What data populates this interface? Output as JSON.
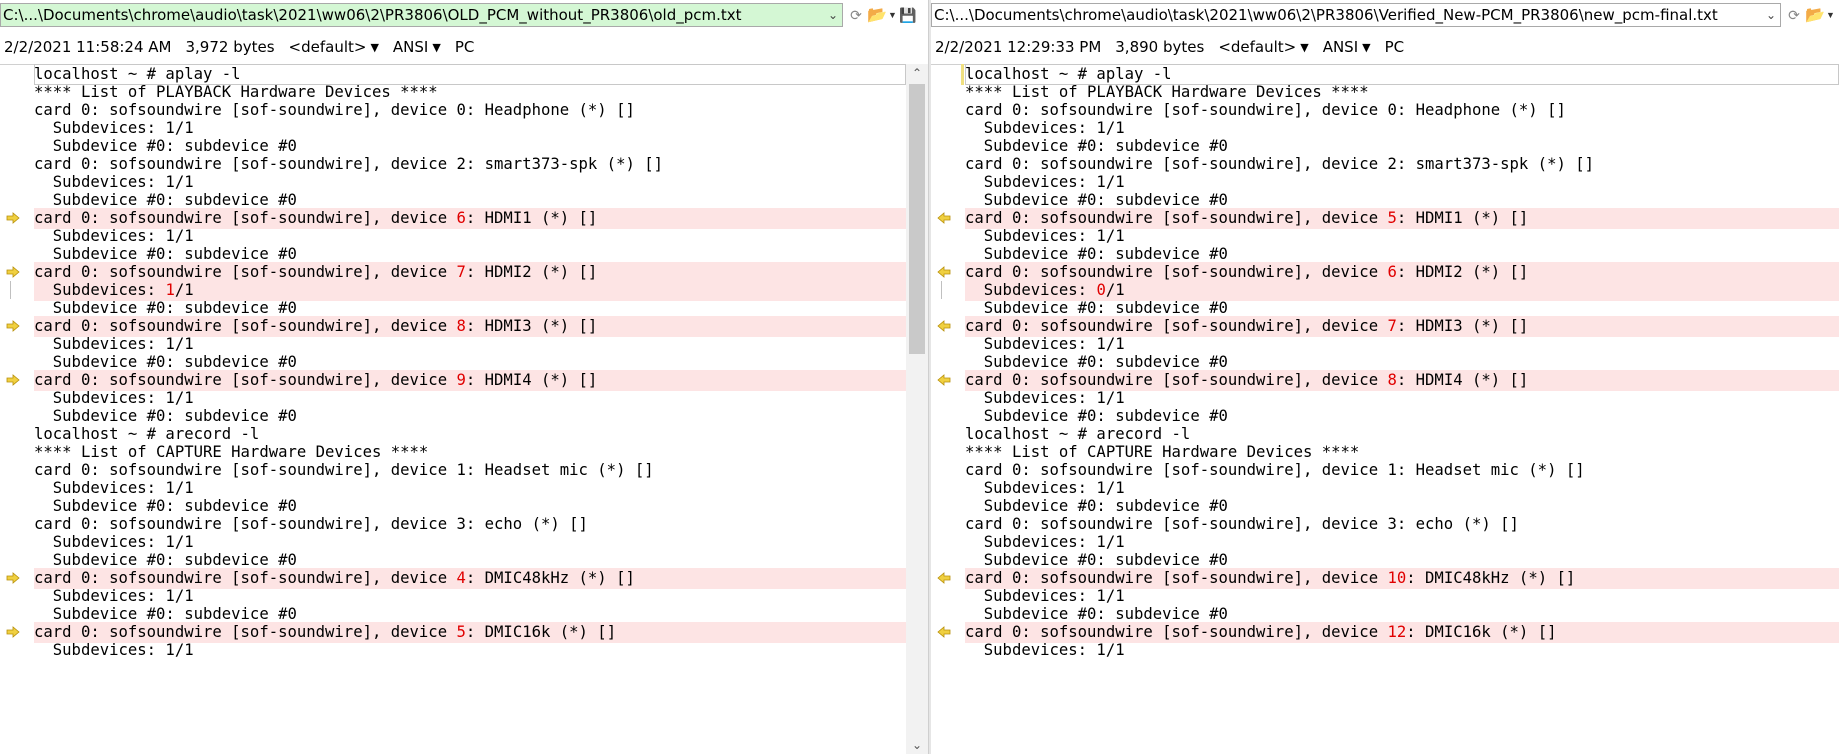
{
  "left": {
    "path": "C:\\...\\Documents\\chrome\\audio\\task\\2021\\ww06\\2\\PR3806\\OLD_PCM_without_PR3806\\old_pcm.txt",
    "timestamp": "2/2/2021 11:58:24 AM",
    "size": "3,972 bytes",
    "ruleset": "<default>",
    "encoding": "ANSI",
    "line_ending": "PC",
    "lines": [
      {
        "segs": [
          "localhost ~ # aplay -l"
        ],
        "diff": false,
        "cursor": true
      },
      {
        "segs": [
          "**** List of PLAYBACK Hardware Devices ****"
        ],
        "diff": false
      },
      {
        "segs": [
          "card 0: sofsoundwire [sof-soundwire], device 0: Headphone (*) []"
        ],
        "diff": false
      },
      {
        "segs": [
          "  Subdevices: 1/1"
        ],
        "diff": false
      },
      {
        "segs": [
          "  Subdevice #0: subdevice #0"
        ],
        "diff": false
      },
      {
        "segs": [
          "card 0: sofsoundwire [sof-soundwire], device 2: smart373-spk (*) []"
        ],
        "diff": false
      },
      {
        "segs": [
          "  Subdevices: 1/1"
        ],
        "diff": false
      },
      {
        "segs": [
          "  Subdevice #0: subdevice #0"
        ],
        "diff": false
      },
      {
        "segs": [
          "card 0: sofsoundwire [sof-soundwire], device ",
          "6",
          ": HDMI1 (*) []"
        ],
        "diff": true
      },
      {
        "segs": [
          "  Subdevices: 1/1"
        ],
        "diff": false
      },
      {
        "segs": [
          "  Subdevice #0: subdevice #0"
        ],
        "diff": false
      },
      {
        "segs": [
          "card 0: sofsoundwire [sof-soundwire], device ",
          "7",
          ": HDMI2 (*) []"
        ],
        "diff": true
      },
      {
        "segs": [
          "  Subdevices: ",
          "1",
          "/1"
        ],
        "diff": true,
        "bar": true
      },
      {
        "segs": [
          "  Subdevice #0: subdevice #0"
        ],
        "diff": false
      },
      {
        "segs": [
          "card 0: sofsoundwire [sof-soundwire], device ",
          "8",
          ": HDMI3 (*) []"
        ],
        "diff": true
      },
      {
        "segs": [
          "  Subdevices: 1/1"
        ],
        "diff": false
      },
      {
        "segs": [
          "  Subdevice #0: subdevice #0"
        ],
        "diff": false
      },
      {
        "segs": [
          "card 0: sofsoundwire [sof-soundwire], device ",
          "9",
          ": HDMI4 (*) []"
        ],
        "diff": true
      },
      {
        "segs": [
          "  Subdevices: 1/1"
        ],
        "diff": false
      },
      {
        "segs": [
          "  Subdevice #0: subdevice #0"
        ],
        "diff": false
      },
      {
        "segs": [
          "localhost ~ # arecord -l"
        ],
        "diff": false
      },
      {
        "segs": [
          "**** List of CAPTURE Hardware Devices ****"
        ],
        "diff": false
      },
      {
        "segs": [
          "card 0: sofsoundwire [sof-soundwire], device 1: Headset mic (*) []"
        ],
        "diff": false
      },
      {
        "segs": [
          "  Subdevices: 1/1"
        ],
        "diff": false
      },
      {
        "segs": [
          "  Subdevice #0: subdevice #0"
        ],
        "diff": false
      },
      {
        "segs": [
          "card 0: sofsoundwire [sof-soundwire], device 3: echo (*) []"
        ],
        "diff": false
      },
      {
        "segs": [
          "  Subdevices: 1/1"
        ],
        "diff": false
      },
      {
        "segs": [
          "  Subdevice #0: subdevice #0"
        ],
        "diff": false
      },
      {
        "segs": [
          "card 0: sofsoundwire [sof-soundwire], device ",
          "4",
          ": DMIC48kHz (*) []"
        ],
        "diff": true
      },
      {
        "segs": [
          "  Subdevices: 1/1"
        ],
        "diff": false
      },
      {
        "segs": [
          "  Subdevice #0: subdevice #0"
        ],
        "diff": false
      },
      {
        "segs": [
          "card 0: sofsoundwire [sof-soundwire], device ",
          "5",
          ": DMIC16k (*) []"
        ],
        "diff": true
      },
      {
        "segs": [
          "  Subdevices: 1/1"
        ],
        "diff": false
      }
    ]
  },
  "right": {
    "path": "C:\\...\\Documents\\chrome\\audio\\task\\2021\\ww06\\2\\PR3806\\Verified_New-PCM_PR3806\\new_pcm-final.txt",
    "timestamp": "2/2/2021 12:29:33 PM",
    "size": "3,890 bytes",
    "ruleset": "<default>",
    "encoding": "ANSI",
    "line_ending": "PC",
    "lines": [
      {
        "segs": [
          "localhost ~ # aplay -l"
        ],
        "diff": false,
        "cursor": true
      },
      {
        "segs": [
          "**** List of PLAYBACK Hardware Devices ****"
        ],
        "diff": false
      },
      {
        "segs": [
          "card 0: sofsoundwire [sof-soundwire], device 0: Headphone (*) []"
        ],
        "diff": false
      },
      {
        "segs": [
          "  Subdevices: 1/1"
        ],
        "diff": false
      },
      {
        "segs": [
          "  Subdevice #0: subdevice #0"
        ],
        "diff": false
      },
      {
        "segs": [
          "card 0: sofsoundwire [sof-soundwire], device 2: smart373-spk (*) []"
        ],
        "diff": false
      },
      {
        "segs": [
          "  Subdevices: 1/1"
        ],
        "diff": false
      },
      {
        "segs": [
          "  Subdevice #0: subdevice #0"
        ],
        "diff": false
      },
      {
        "segs": [
          "card 0: sofsoundwire [sof-soundwire], device ",
          "5",
          ": HDMI1 (*) []"
        ],
        "diff": true
      },
      {
        "segs": [
          "  Subdevices: 1/1"
        ],
        "diff": false
      },
      {
        "segs": [
          "  Subdevice #0: subdevice #0"
        ],
        "diff": false
      },
      {
        "segs": [
          "card 0: sofsoundwire [sof-soundwire], device ",
          "6",
          ": HDMI2 (*) []"
        ],
        "diff": true
      },
      {
        "segs": [
          "  Subdevices: ",
          "0",
          "/1"
        ],
        "diff": true,
        "bar": true
      },
      {
        "segs": [
          "  Subdevice #0: subdevice #0"
        ],
        "diff": false
      },
      {
        "segs": [
          "card 0: sofsoundwire [sof-soundwire], device ",
          "7",
          ": HDMI3 (*) []"
        ],
        "diff": true
      },
      {
        "segs": [
          "  Subdevices: 1/1"
        ],
        "diff": false
      },
      {
        "segs": [
          "  Subdevice #0: subdevice #0"
        ],
        "diff": false
      },
      {
        "segs": [
          "card 0: sofsoundwire [sof-soundwire], device ",
          "8",
          ": HDMI4 (*) []"
        ],
        "diff": true
      },
      {
        "segs": [
          "  Subdevices: 1/1"
        ],
        "diff": false
      },
      {
        "segs": [
          "  Subdevice #0: subdevice #0"
        ],
        "diff": false
      },
      {
        "segs": [
          "localhost ~ # arecord -l"
        ],
        "diff": false
      },
      {
        "segs": [
          "**** List of CAPTURE Hardware Devices ****"
        ],
        "diff": false
      },
      {
        "segs": [
          "card 0: sofsoundwire [sof-soundwire], device 1: Headset mic (*) []"
        ],
        "diff": false
      },
      {
        "segs": [
          "  Subdevices: 1/1"
        ],
        "diff": false
      },
      {
        "segs": [
          "  Subdevice #0: subdevice #0"
        ],
        "diff": false
      },
      {
        "segs": [
          "card 0: sofsoundwire [sof-soundwire], device 3: echo (*) []"
        ],
        "diff": false
      },
      {
        "segs": [
          "  Subdevices: 1/1"
        ],
        "diff": false
      },
      {
        "segs": [
          "  Subdevice #0: subdevice #0"
        ],
        "diff": false
      },
      {
        "segs": [
          "card 0: sofsoundwire [sof-soundwire], device ",
          "10",
          ": DMIC48kHz (*) []"
        ],
        "diff": true
      },
      {
        "segs": [
          "  Subdevices: 1/1"
        ],
        "diff": false
      },
      {
        "segs": [
          "  Subdevice #0: subdevice #0"
        ],
        "diff": false
      },
      {
        "segs": [
          "card 0: sofsoundwire [sof-soundwire], device ",
          "12",
          ": DMIC16k (*) []"
        ],
        "diff": true
      },
      {
        "segs": [
          "  Subdevices: 1/1"
        ],
        "diff": false
      }
    ]
  },
  "colors": {
    "diff_background": "#fde4e4",
    "diff_text": "#e00000",
    "left_path_background": "#d4f7d4",
    "diff_arrow": "#f0d040"
  },
  "icons": {
    "dropdown": "chevron-down-icon",
    "open": "open-folder-icon",
    "save": "save-icon",
    "left_diff_marker": "arrow-right-icon",
    "right_diff_marker": "arrow-left-icon"
  }
}
